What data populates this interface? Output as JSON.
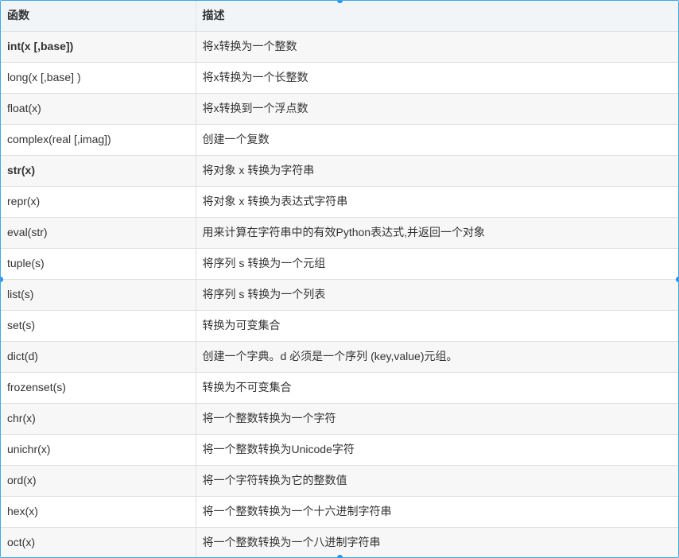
{
  "table": {
    "headers": [
      "函数",
      "描述"
    ],
    "rows": [
      {
        "func": "int(x [,base])",
        "desc": "将x转换为一个整数",
        "bold": true
      },
      {
        "func": "long(x [,base] )",
        "desc": "将x转换为一个长整数",
        "bold": false
      },
      {
        "func": "float(x)",
        "desc": "将x转换到一个浮点数",
        "bold": false
      },
      {
        "func": "complex(real [,imag])",
        "desc": "创建一个复数",
        "bold": false
      },
      {
        "func": "str(x)",
        "desc": "将对象 x 转换为字符串",
        "bold": true
      },
      {
        "func": "repr(x)",
        "desc": "将对象 x 转换为表达式字符串",
        "bold": false
      },
      {
        "func": "eval(str)",
        "desc": "用来计算在字符串中的有效Python表达式,并返回一个对象",
        "bold": false
      },
      {
        "func": "tuple(s)",
        "desc": "将序列 s 转换为一个元组",
        "bold": false
      },
      {
        "func": "list(s)",
        "desc": "将序列 s 转换为一个列表",
        "bold": false
      },
      {
        "func": "set(s)",
        "desc": "转换为可变集合",
        "bold": false
      },
      {
        "func": "dict(d)",
        "desc": "创建一个字典。d 必须是一个序列 (key,value)元组。",
        "bold": false
      },
      {
        "func": "frozenset(s)",
        "desc": "转换为不可变集合",
        "bold": false
      },
      {
        "func": "chr(x)",
        "desc": "将一个整数转换为一个字符",
        "bold": false
      },
      {
        "func": "unichr(x)",
        "desc": "将一个整数转换为Unicode字符",
        "bold": false
      },
      {
        "func": "ord(x)",
        "desc": "将一个字符转换为它的整数值",
        "bold": false
      },
      {
        "func": "hex(x)",
        "desc": "将一个整数转换为一个十六进制字符串",
        "bold": false
      },
      {
        "func": "oct(x)",
        "desc": "将一个整数转换为一个八进制字符串",
        "bold": false
      }
    ]
  },
  "colors": {
    "border_accent": "#3fa9e0",
    "handle": "#1e90ff",
    "header_bg": "#f2f5f8",
    "row_alt_bg": "#f7f7f7",
    "text": "#333333"
  }
}
